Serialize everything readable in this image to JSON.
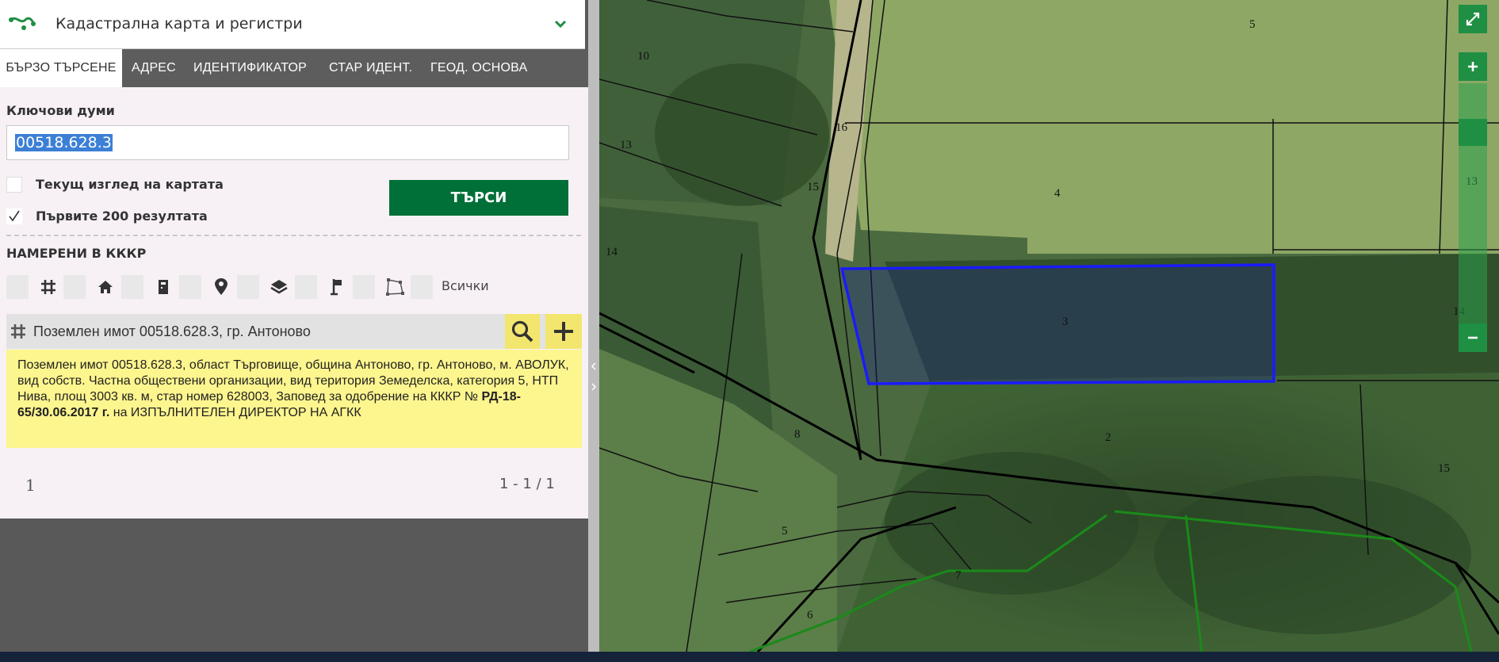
{
  "app": {
    "title": "Кадастрална карта и регистри",
    "logo_icon": "cadastre-logo-icon",
    "chevron_icon": "chevron-down-icon",
    "accent_color": "#006f38"
  },
  "tabs": [
    {
      "label": "БЪРЗО ТЪРСЕНЕ",
      "active": true
    },
    {
      "label": "АДРЕС",
      "active": false
    },
    {
      "label": "ИДЕНТИФИКАТОР",
      "active": false
    },
    {
      "label": "СТАР ИДЕНТ.",
      "active": false
    },
    {
      "label": "ГЕОД. ОСНОВА",
      "active": false
    }
  ],
  "search": {
    "keywords_label": "Ключови думи",
    "keywords_value": "00518.628.3",
    "current_view_label": "Текущ изглед на картата",
    "current_view_checked": false,
    "first200_label": "Първите 200 резултата",
    "first200_checked": true,
    "search_button": "ТЪРСИ"
  },
  "results": {
    "heading": "НАМЕРЕНИ В КККР",
    "filter_icons": [
      "parcel-grid-icon",
      "house-icon",
      "building-icon",
      "location-pin-icon",
      "layers-icon",
      "survey-flag-icon",
      "polygon-icon"
    ],
    "all_label": "Всички",
    "item_title": "Поземлен имот 00518.628.3, гр. Антоново",
    "detail_pre": "Поземлен имот 00518.628.3, област Търговище, община Антоново, гр. Антоново, м. АВОЛУК, вид собств. Частна обществени организации, вид територия Земеделска, категория 5, НТП Нива, площ 3003 кв. м, стар номер 628003, Заповед за одобрение на КККР № ",
    "detail_order": "РД-18-65/30.06.2017 г.",
    "detail_post": " на ИЗПЪЛНИТЕЛЕН ДИРЕКТОР НА АГКК",
    "pager_page": "1",
    "pager_range": "1 - 1 / 1"
  },
  "map": {
    "parcel_labels": [
      "10",
      "5",
      "13",
      "16",
      "15",
      "4",
      "13",
      "14",
      "3",
      "14",
      "8",
      "2",
      "15",
      "5",
      "7",
      "6"
    ],
    "highlight_color": "#1a1aff",
    "controls": [
      "fullscreen-icon",
      "zoom-in-icon",
      "zoom-out-icon"
    ]
  }
}
